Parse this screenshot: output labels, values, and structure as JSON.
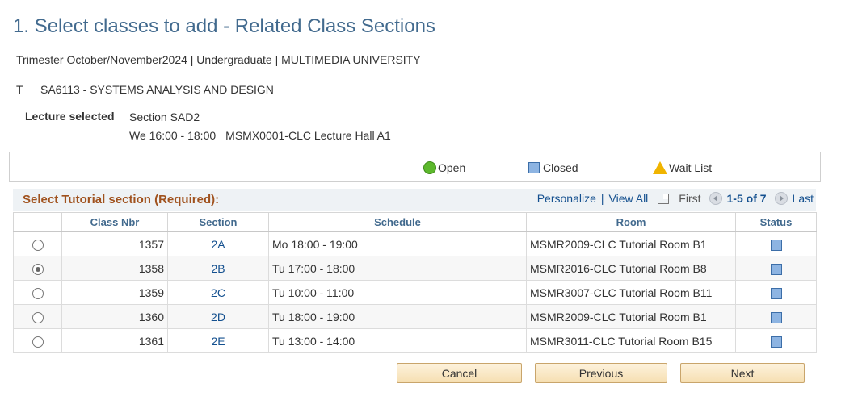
{
  "page": {
    "title": "1.  Select classes to add - Related Class Sections",
    "term_info": "Trimester October/November2024 | Undergraduate | MULTIMEDIA UNIVERSITY",
    "course_prefix": "T",
    "course_name": "SA6113 - SYSTEMS ANALYSIS AND DESIGN"
  },
  "lecture": {
    "label": "Lecture selected",
    "section": "Section SAD2",
    "schedule": "We 16:00 - 18:00",
    "room": "MSMX0001-CLC Lecture Hall A1"
  },
  "legend": {
    "open": "Open",
    "closed": "Closed",
    "wait_list": "Wait List"
  },
  "grid": {
    "title": "Select Tutorial section (Required):",
    "personalize": "Personalize",
    "view_all": "View All",
    "first": "First",
    "range": "1-5 of 7",
    "last": "Last",
    "columns": {
      "select": "",
      "class_nbr": "Class Nbr",
      "section": "Section",
      "schedule": "Schedule",
      "room": "Room",
      "status": "Status"
    },
    "rows": [
      {
        "selected": false,
        "class_nbr": "1357",
        "section": "2A",
        "schedule": "Mo 18:00 - 19:00",
        "room": "MSMR2009-CLC Tutorial Room B1",
        "status": "Closed"
      },
      {
        "selected": true,
        "class_nbr": "1358",
        "section": "2B",
        "schedule": "Tu 17:00 - 18:00",
        "room": "MSMR2016-CLC Tutorial Room B8",
        "status": "Closed"
      },
      {
        "selected": false,
        "class_nbr": "1359",
        "section": "2C",
        "schedule": "Tu 10:00 - 11:00",
        "room": "MSMR3007-CLC Tutorial Room B11",
        "status": "Closed"
      },
      {
        "selected": false,
        "class_nbr": "1360",
        "section": "2D",
        "schedule": "Tu 18:00 - 19:00",
        "room": "MSMR2009-CLC Tutorial Room B1",
        "status": "Closed"
      },
      {
        "selected": false,
        "class_nbr": "1361",
        "section": "2E",
        "schedule": "Tu 13:00 - 14:00",
        "room": "MSMR3011-CLC Tutorial Room B15",
        "status": "Closed"
      }
    ]
  },
  "buttons": {
    "cancel": "Cancel",
    "previous": "Previous",
    "next": "Next"
  },
  "colors": {
    "title": "#426a8e",
    "grid_title": "#a0521e",
    "link": "#14508f",
    "open": "#5cb82c",
    "closed": "#8db4e2",
    "wait_list": "#f0b400"
  }
}
